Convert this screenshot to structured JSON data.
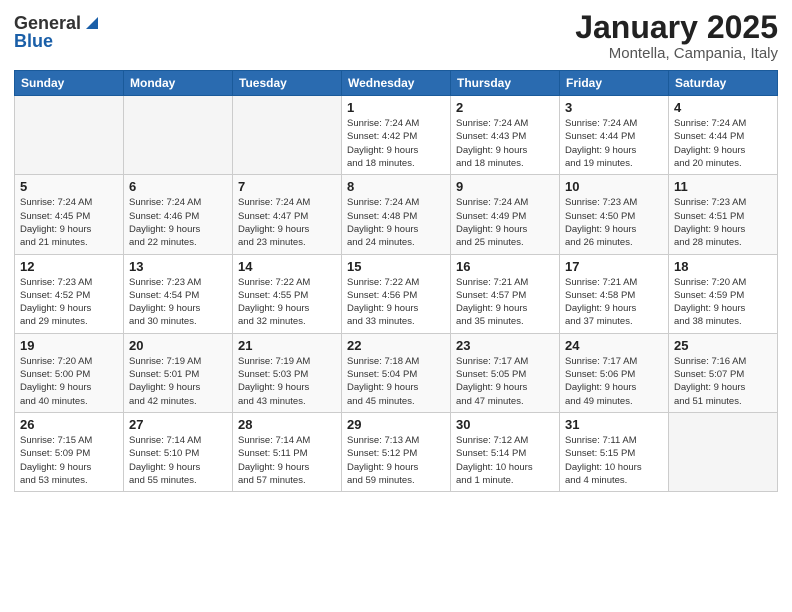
{
  "header": {
    "logo_general": "General",
    "logo_blue": "Blue",
    "month_title": "January 2025",
    "location": "Montella, Campania, Italy"
  },
  "weekdays": [
    "Sunday",
    "Monday",
    "Tuesday",
    "Wednesday",
    "Thursday",
    "Friday",
    "Saturday"
  ],
  "weeks": [
    {
      "days": [
        {
          "num": "",
          "info": ""
        },
        {
          "num": "",
          "info": ""
        },
        {
          "num": "",
          "info": ""
        },
        {
          "num": "1",
          "info": "Sunrise: 7:24 AM\nSunset: 4:42 PM\nDaylight: 9 hours\nand 18 minutes."
        },
        {
          "num": "2",
          "info": "Sunrise: 7:24 AM\nSunset: 4:43 PM\nDaylight: 9 hours\nand 18 minutes."
        },
        {
          "num": "3",
          "info": "Sunrise: 7:24 AM\nSunset: 4:44 PM\nDaylight: 9 hours\nand 19 minutes."
        },
        {
          "num": "4",
          "info": "Sunrise: 7:24 AM\nSunset: 4:44 PM\nDaylight: 9 hours\nand 20 minutes."
        }
      ]
    },
    {
      "days": [
        {
          "num": "5",
          "info": "Sunrise: 7:24 AM\nSunset: 4:45 PM\nDaylight: 9 hours\nand 21 minutes."
        },
        {
          "num": "6",
          "info": "Sunrise: 7:24 AM\nSunset: 4:46 PM\nDaylight: 9 hours\nand 22 minutes."
        },
        {
          "num": "7",
          "info": "Sunrise: 7:24 AM\nSunset: 4:47 PM\nDaylight: 9 hours\nand 23 minutes."
        },
        {
          "num": "8",
          "info": "Sunrise: 7:24 AM\nSunset: 4:48 PM\nDaylight: 9 hours\nand 24 minutes."
        },
        {
          "num": "9",
          "info": "Sunrise: 7:24 AM\nSunset: 4:49 PM\nDaylight: 9 hours\nand 25 minutes."
        },
        {
          "num": "10",
          "info": "Sunrise: 7:23 AM\nSunset: 4:50 PM\nDaylight: 9 hours\nand 26 minutes."
        },
        {
          "num": "11",
          "info": "Sunrise: 7:23 AM\nSunset: 4:51 PM\nDaylight: 9 hours\nand 28 minutes."
        }
      ]
    },
    {
      "days": [
        {
          "num": "12",
          "info": "Sunrise: 7:23 AM\nSunset: 4:52 PM\nDaylight: 9 hours\nand 29 minutes."
        },
        {
          "num": "13",
          "info": "Sunrise: 7:23 AM\nSunset: 4:54 PM\nDaylight: 9 hours\nand 30 minutes."
        },
        {
          "num": "14",
          "info": "Sunrise: 7:22 AM\nSunset: 4:55 PM\nDaylight: 9 hours\nand 32 minutes."
        },
        {
          "num": "15",
          "info": "Sunrise: 7:22 AM\nSunset: 4:56 PM\nDaylight: 9 hours\nand 33 minutes."
        },
        {
          "num": "16",
          "info": "Sunrise: 7:21 AM\nSunset: 4:57 PM\nDaylight: 9 hours\nand 35 minutes."
        },
        {
          "num": "17",
          "info": "Sunrise: 7:21 AM\nSunset: 4:58 PM\nDaylight: 9 hours\nand 37 minutes."
        },
        {
          "num": "18",
          "info": "Sunrise: 7:20 AM\nSunset: 4:59 PM\nDaylight: 9 hours\nand 38 minutes."
        }
      ]
    },
    {
      "days": [
        {
          "num": "19",
          "info": "Sunrise: 7:20 AM\nSunset: 5:00 PM\nDaylight: 9 hours\nand 40 minutes."
        },
        {
          "num": "20",
          "info": "Sunrise: 7:19 AM\nSunset: 5:01 PM\nDaylight: 9 hours\nand 42 minutes."
        },
        {
          "num": "21",
          "info": "Sunrise: 7:19 AM\nSunset: 5:03 PM\nDaylight: 9 hours\nand 43 minutes."
        },
        {
          "num": "22",
          "info": "Sunrise: 7:18 AM\nSunset: 5:04 PM\nDaylight: 9 hours\nand 45 minutes."
        },
        {
          "num": "23",
          "info": "Sunrise: 7:17 AM\nSunset: 5:05 PM\nDaylight: 9 hours\nand 47 minutes."
        },
        {
          "num": "24",
          "info": "Sunrise: 7:17 AM\nSunset: 5:06 PM\nDaylight: 9 hours\nand 49 minutes."
        },
        {
          "num": "25",
          "info": "Sunrise: 7:16 AM\nSunset: 5:07 PM\nDaylight: 9 hours\nand 51 minutes."
        }
      ]
    },
    {
      "days": [
        {
          "num": "26",
          "info": "Sunrise: 7:15 AM\nSunset: 5:09 PM\nDaylight: 9 hours\nand 53 minutes."
        },
        {
          "num": "27",
          "info": "Sunrise: 7:14 AM\nSunset: 5:10 PM\nDaylight: 9 hours\nand 55 minutes."
        },
        {
          "num": "28",
          "info": "Sunrise: 7:14 AM\nSunset: 5:11 PM\nDaylight: 9 hours\nand 57 minutes."
        },
        {
          "num": "29",
          "info": "Sunrise: 7:13 AM\nSunset: 5:12 PM\nDaylight: 9 hours\nand 59 minutes."
        },
        {
          "num": "30",
          "info": "Sunrise: 7:12 AM\nSunset: 5:14 PM\nDaylight: 10 hours\nand 1 minute."
        },
        {
          "num": "31",
          "info": "Sunrise: 7:11 AM\nSunset: 5:15 PM\nDaylight: 10 hours\nand 4 minutes."
        },
        {
          "num": "",
          "info": ""
        }
      ]
    }
  ]
}
